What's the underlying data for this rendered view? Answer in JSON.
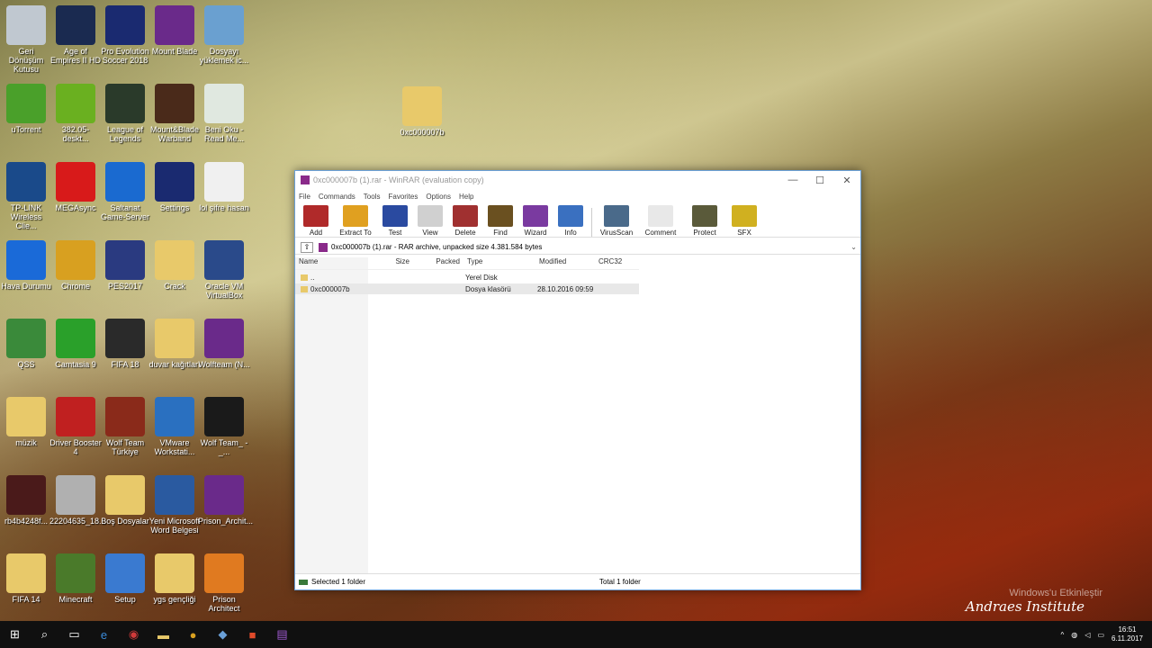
{
  "desktop_icons": [
    {
      "label": "Geri Dönüşüm Kutusu",
      "color": "#c0c8d0"
    },
    {
      "label": "Age of Empires II HD",
      "color": "#1a2a50"
    },
    {
      "label": "Pro Evolution Soccer 2018",
      "color": "#1a2a70"
    },
    {
      "label": "Mount Blade",
      "color": "#6a2a8a"
    },
    {
      "label": "Dosyayı yüklemek ic...",
      "color": "#6aa0d0"
    },
    {
      "label": "uTorrent",
      "color": "#4aa02a"
    },
    {
      "label": "382.05-deskt...",
      "color": "#6ab020"
    },
    {
      "label": "League of Legends",
      "color": "#2a3a2a"
    },
    {
      "label": "Mount&Blade Warband",
      "color": "#4a2a1a"
    },
    {
      "label": "Beni Oku - Read Me...",
      "color": "#e0e8e0"
    },
    {
      "label": "TP-LINK Wireless Clie...",
      "color": "#1a4a8a"
    },
    {
      "label": "MEGAsync",
      "color": "#d81a1a"
    },
    {
      "label": "Saltanat Game-Server",
      "color": "#1a6ad0"
    },
    {
      "label": "Settings",
      "color": "#1a2a70"
    },
    {
      "label": "lol şifre hasan",
      "color": "#f0f0f0"
    },
    {
      "label": "Hava Durumu",
      "color": "#1a6ad8"
    },
    {
      "label": "Chrome",
      "color": "#d8a020"
    },
    {
      "label": "PES2017",
      "color": "#2a3a80"
    },
    {
      "label": "Crack",
      "color": "#e8c96a"
    },
    {
      "label": "Oracle VM VirtualBox",
      "color": "#2a4a8a"
    },
    {
      "label": "QSS",
      "color": "#3a8a3a"
    },
    {
      "label": "Camtasia 9",
      "color": "#2aa02a"
    },
    {
      "label": "FIFA 18",
      "color": "#2a2a2a"
    },
    {
      "label": "duvar kağıtları",
      "color": "#e8c96a"
    },
    {
      "label": "Wolfteam (N...",
      "color": "#6a2a8a"
    },
    {
      "label": "müzik",
      "color": "#e8c96a"
    },
    {
      "label": "Driver Booster 4",
      "color": "#c02020"
    },
    {
      "label": "Wolf Team Türkiye",
      "color": "#8a2a1a"
    },
    {
      "label": "VMware Workstati...",
      "color": "#2a70c0"
    },
    {
      "label": "Wolf Team_ -_...",
      "color": "#1a1a1a"
    },
    {
      "label": "rb4b4248f...",
      "color": "#4a1a1a"
    },
    {
      "label": "22204635_18...",
      "color": "#b0b0b0"
    },
    {
      "label": "Boş Dosyalar",
      "color": "#e8c96a"
    },
    {
      "label": "Yeni Microsoft Word Belgesi",
      "color": "#2a5aa0"
    },
    {
      "label": "Prison_Archit...",
      "color": "#6a2a8a"
    },
    {
      "label": "FIFA 14",
      "color": "#e8c96a"
    },
    {
      "label": "Minecraft",
      "color": "#4a7a2a"
    },
    {
      "label": "Setup",
      "color": "#3a7ad0"
    },
    {
      "label": "ygs gençliği",
      "color": "#e8c96a"
    },
    {
      "label": "Prison Architect",
      "color": "#e07a20"
    }
  ],
  "loose_folder": {
    "label": "0xc000007b"
  },
  "window": {
    "title": "0xc000007b (1).rar - WinRAR (evaluation copy)",
    "controls": {
      "minimize": "—",
      "maximize": "☐",
      "close": "✕"
    },
    "menu": [
      "File",
      "Commands",
      "Tools",
      "Favorites",
      "Options",
      "Help"
    ],
    "toolbar": [
      {
        "label": "Add",
        "color": "#b02a2a"
      },
      {
        "label": "Extract To",
        "color": "#e0a020"
      },
      {
        "label": "Test",
        "color": "#2a4aa0"
      },
      {
        "label": "View",
        "color": "#d0d0d0"
      },
      {
        "label": "Delete",
        "color": "#a03030"
      },
      {
        "label": "Find",
        "color": "#6a5020"
      },
      {
        "label": "Wizard",
        "color": "#7a3aa0"
      },
      {
        "label": "Info",
        "color": "#3a70c0"
      },
      {
        "label": "VirusScan",
        "color": "#4a6a8a"
      },
      {
        "label": "Comment",
        "color": "#e8e8e8"
      },
      {
        "label": "Protect",
        "color": "#5a5a3a"
      },
      {
        "label": "SFX",
        "color": "#d0b020"
      }
    ],
    "path": "0xc000007b (1).rar - RAR archive, unpacked size 4.381.584 bytes",
    "columns": [
      "Name",
      "Size",
      "Packed",
      "Type",
      "Modified",
      "CRC32"
    ],
    "rows": [
      {
        "name": "..",
        "size": "",
        "packed": "",
        "type": "Yerel Disk",
        "modified": "",
        "crc": ""
      },
      {
        "name": "0xc000007b",
        "size": "",
        "packed": "",
        "type": "Dosya klasörü",
        "modified": "28.10.2016 09:59",
        "crc": ""
      }
    ],
    "status_left": "Selected 1 folder",
    "status_right": "Total 1 folder"
  },
  "watermark": {
    "line1": "Windows'u Etkinleştir",
    "line2": "Andraes Institute"
  },
  "taskbar": {
    "time": "16:51",
    "date": "6.11.2017"
  }
}
